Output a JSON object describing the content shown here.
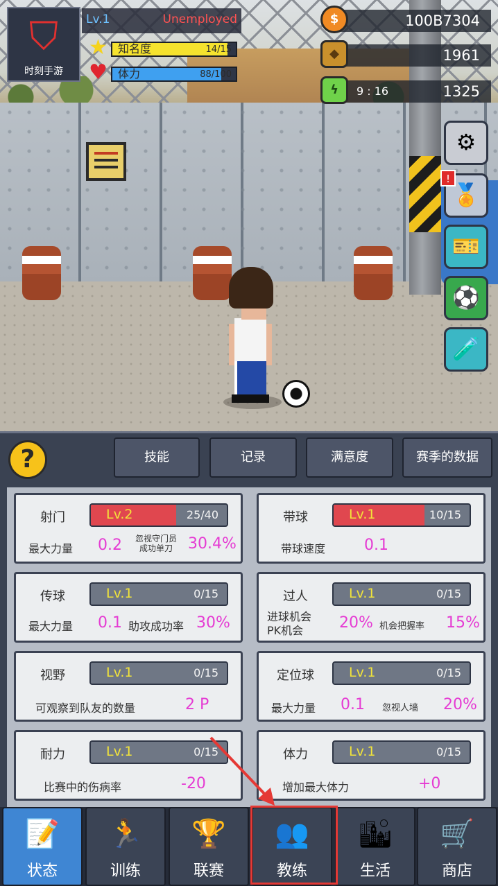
{
  "hud": {
    "logo_text": "时刻手游",
    "level": "Lv.1",
    "job": "Unemployed",
    "fame": {
      "label": "知名度",
      "value": "14/15",
      "fraction": 0.93,
      "color": "#f5e22e"
    },
    "stamina": {
      "label": "体力",
      "value": "88/100",
      "fraction": 0.88,
      "color": "#3fa0f0"
    }
  },
  "resources": {
    "coins": {
      "icon": "coin-icon",
      "value": "100B7304"
    },
    "gems": {
      "icon": "gem-icon",
      "value": "1961"
    },
    "energy": {
      "icon": "energy-icon",
      "timer": "9 : 16",
      "value": "1325"
    }
  },
  "side_buttons": [
    {
      "name": "settings-button",
      "icon": "⚙",
      "color": "#c9ccd3"
    },
    {
      "name": "medal-button",
      "icon": "🏅",
      "color": "#bfc8d6",
      "badge": "!"
    },
    {
      "name": "ticket-button",
      "icon": "🎫",
      "color": "#3bb7c5"
    },
    {
      "name": "football-button",
      "icon": "⚽",
      "color": "#38a84d"
    },
    {
      "name": "item-button",
      "icon": "🧪",
      "color": "#3bb7c5"
    }
  ],
  "tabs": [
    "技能",
    "记录",
    "满意度",
    "赛季的数据"
  ],
  "help_label": "?",
  "skills": {
    "shooting": {
      "name": "射门",
      "level": "Lv.2",
      "progress": "25/40",
      "fraction": 0.625,
      "attr1": "最大力量",
      "val1": "0.2",
      "attr2_line1": "忽视守门员",
      "attr2_line2": "成功单刀",
      "val2": "30.4%"
    },
    "dribbling": {
      "name": "带球",
      "level": "Lv.1",
      "progress": "10/15",
      "fraction": 0.667,
      "attr1": "带球速度",
      "val1": "0.1"
    },
    "passing": {
      "name": "传球",
      "level": "Lv.1",
      "progress": "0/15",
      "fraction": 0,
      "attr1": "最大力量",
      "val1": "0.1",
      "attr2": "助攻成功率",
      "val2": "30%"
    },
    "breakthrough": {
      "name": "过人",
      "level": "Lv.1",
      "progress": "0/15",
      "fraction": 0,
      "attr1_line1": "进球机会",
      "attr1_line2": "PK机会",
      "val1": "20%",
      "attr2": "机会把握率",
      "val2": "15%"
    },
    "vision": {
      "name": "视野",
      "level": "Lv.1",
      "progress": "0/15",
      "fraction": 0,
      "attr1": "可观察到队友的数量",
      "val1": "2 P"
    },
    "set_piece": {
      "name": "定位球",
      "level": "Lv.1",
      "progress": "0/15",
      "fraction": 0,
      "attr1": "最大力量",
      "val1": "0.1",
      "attr2": "忽视人墙",
      "val2": "20%"
    },
    "endurance": {
      "name": "耐力",
      "level": "Lv.1",
      "progress": "0/15",
      "fraction": 0,
      "attr1": "比赛中的伤病率",
      "val1": "-20"
    },
    "stamina": {
      "name": "体力",
      "level": "Lv.1",
      "progress": "0/15",
      "fraction": 0,
      "attr1": "增加最大体力",
      "val1": "+0"
    }
  },
  "nav": [
    {
      "label": "状态",
      "icon": "📝",
      "active": true
    },
    {
      "label": "训练",
      "icon": "🏃"
    },
    {
      "label": "联赛",
      "icon": "🏆"
    },
    {
      "label": "教练",
      "icon": "👥"
    },
    {
      "label": "生活",
      "icon": "🏙"
    },
    {
      "label": "商店",
      "icon": "🛒"
    }
  ]
}
